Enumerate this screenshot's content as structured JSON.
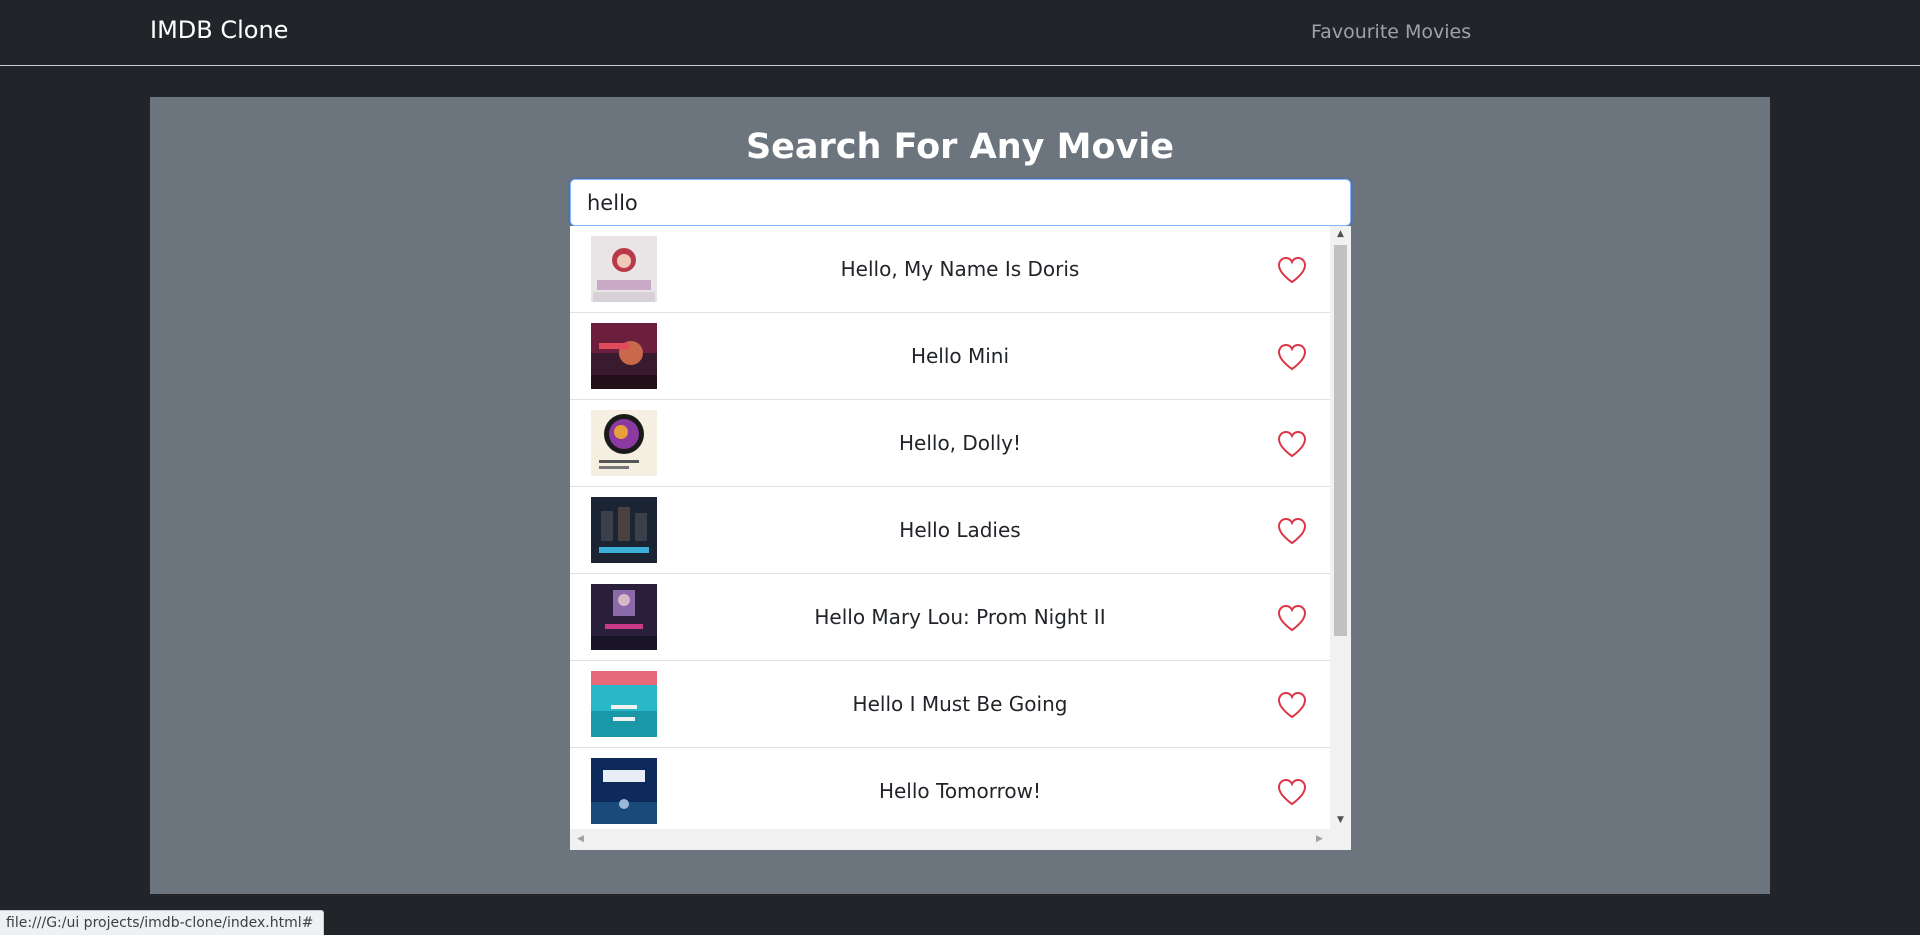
{
  "navbar": {
    "brand": "IMDB Clone",
    "favourites_link": "Favourite Movies"
  },
  "hero": {
    "title": "Search For Any Movie"
  },
  "search": {
    "value": "hello"
  },
  "results": [
    {
      "title": "Hello, My Name Is Doris",
      "icon": "heart-outline-icon"
    },
    {
      "title": "Hello Mini",
      "icon": "heart-outline-icon"
    },
    {
      "title": "Hello, Dolly!",
      "icon": "heart-outline-icon"
    },
    {
      "title": "Hello Ladies",
      "icon": "heart-outline-icon"
    },
    {
      "title": "Hello Mary Lou: Prom Night II",
      "icon": "heart-outline-icon"
    },
    {
      "title": "Hello I Must Be Going",
      "icon": "heart-outline-icon"
    },
    {
      "title": "Hello Tomorrow!",
      "icon": "heart-outline-icon"
    }
  ],
  "status_bar": {
    "url": "file:///G:/ui projects/imdb-clone/index.html#"
  },
  "colors": {
    "page_background": "#212529",
    "hero_background": "#6c757d",
    "heart": "#dc3545",
    "input_focus_border": "#86b7fe"
  }
}
